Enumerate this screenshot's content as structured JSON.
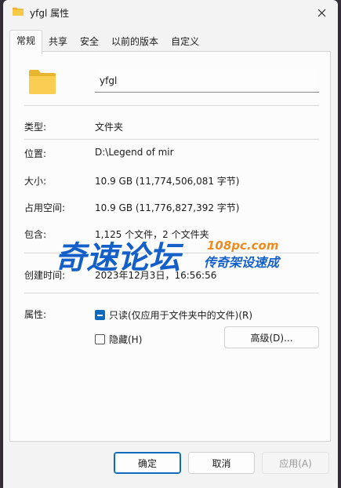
{
  "window": {
    "title": "yfgl 属性"
  },
  "tabs": [
    {
      "label": "常规",
      "active": true
    },
    {
      "label": "共享"
    },
    {
      "label": "安全"
    },
    {
      "label": "以前的版本"
    },
    {
      "label": "自定义"
    }
  ],
  "general": {
    "name_value": "yfgl",
    "type_label": "类型:",
    "type_value": "文件夹",
    "location_label": "位置:",
    "location_value": "D:\\Legend of mir",
    "size_label": "大小:",
    "size_value": "10.9 GB (11,774,506,081 字节)",
    "disk_size_label": "占用空间:",
    "disk_size_value": "10.9 GB (11,776,827,392 字节)",
    "contains_label": "包含:",
    "contains_value": "1,125 个文件，2 个文件夹",
    "created_label": "创建时间:",
    "created_value": "2023年12月3日，16:56:56",
    "attributes_label": "属性:",
    "readonly_label": "只读(仅应用于文件夹中的文件)(R)",
    "hidden_label": "隐藏(H)",
    "advanced_label": "高级(D)..."
  },
  "footer": {
    "ok_label": "确定",
    "cancel_label": "取消",
    "apply_label": "应用(A)"
  },
  "watermark": {
    "main_text": "奇速论坛",
    "url_text": "108pc.com",
    "tagline": "传奇架设速成"
  },
  "colors": {
    "accent": "#0f6cbd",
    "folder": "#f5c543",
    "watermark_blue": "#1560c8",
    "watermark_orange": "#f08a1c"
  }
}
